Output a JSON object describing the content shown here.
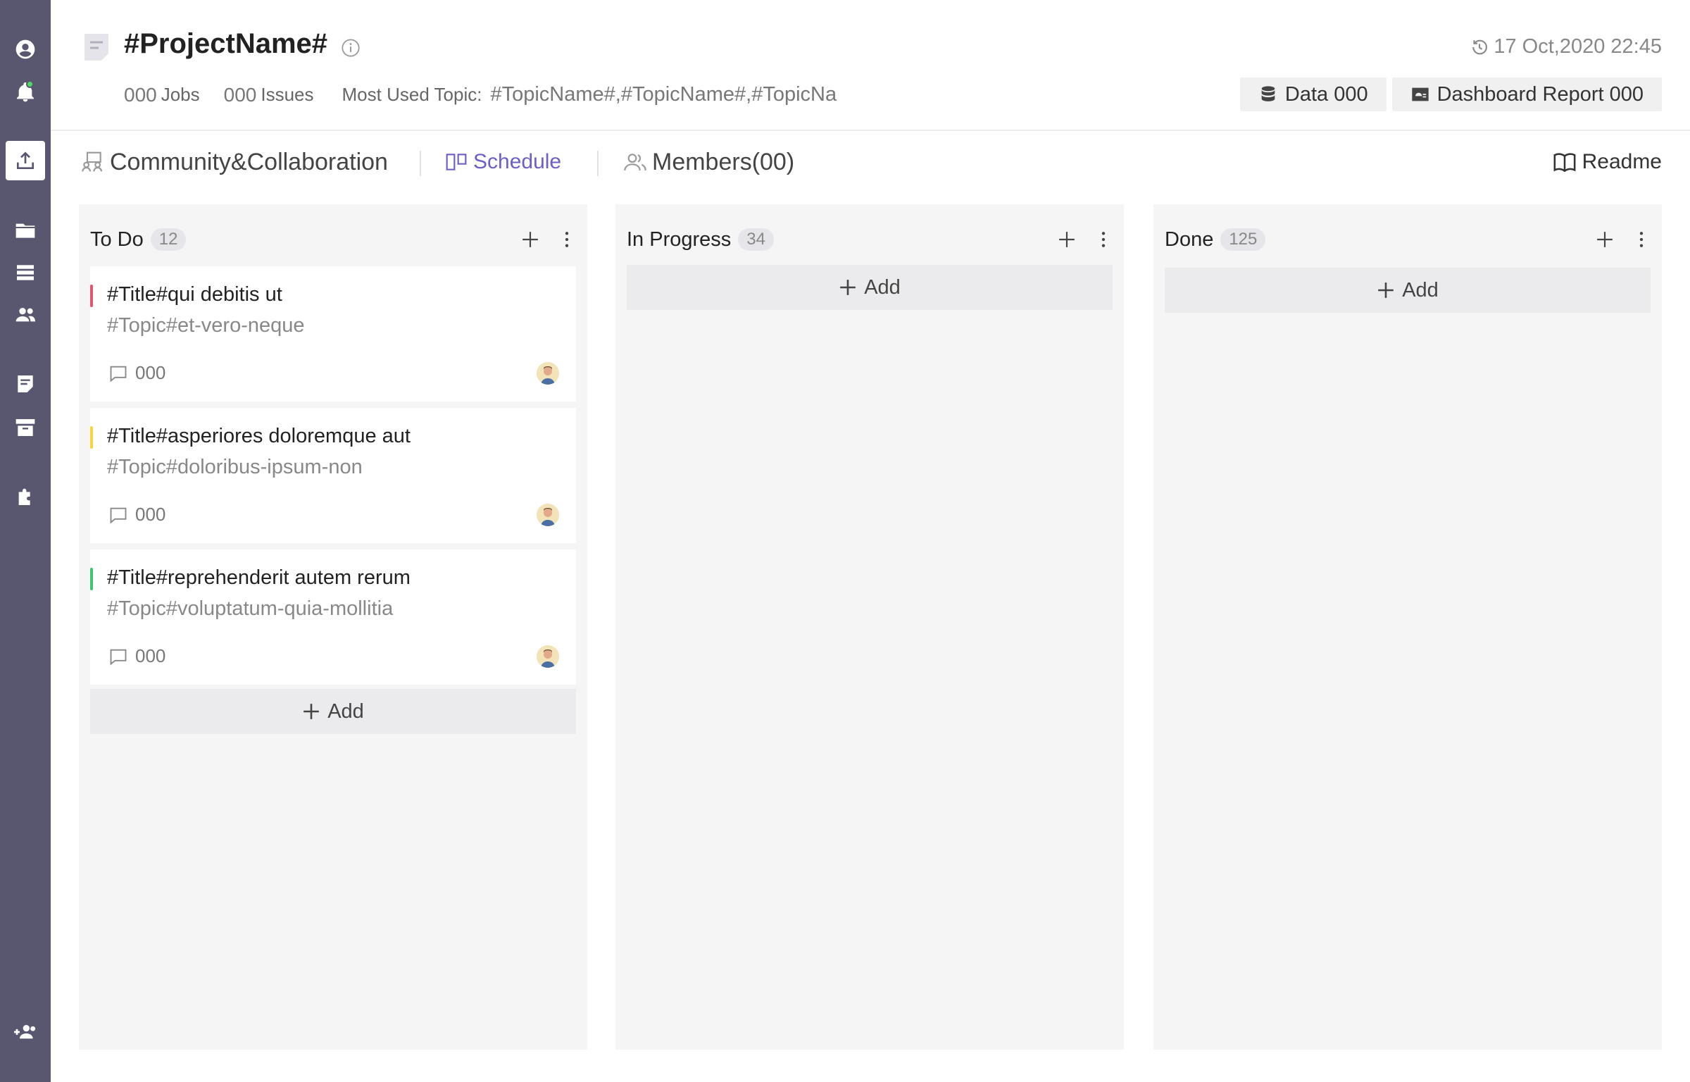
{
  "sidebar": {
    "icons": [
      "user-circle-icon",
      "bell-icon",
      "upload-icon",
      "folder-icon",
      "stack-icon",
      "users-icon",
      "note-icon",
      "archive-icon",
      "puzzle-icon",
      "add-user-icon"
    ],
    "active": "upload-icon"
  },
  "header": {
    "title": "#ProjectName#",
    "timestamp": "17 Oct,2020 22:45",
    "jobs_count": "000",
    "jobs_label": "Jobs",
    "issues_count": "000",
    "issues_label": "Issues",
    "topics_label": "Most Used Topic:",
    "topics": "#TopicName#,#TopicName#,#TopicNa",
    "data_button": "Data 000",
    "dashboard_button": "Dashboard Report 000"
  },
  "tabs": {
    "community": "Community&Collaboration",
    "schedule": "Schedule",
    "members": "Members(00)",
    "readme": "Readme"
  },
  "board": {
    "columns": [
      {
        "title": "To Do",
        "count": "12",
        "add_label": "Add",
        "cards": [
          {
            "title": "#Title#qui debitis ut",
            "topic": "#Topic#et-vero-neque",
            "comments": "000",
            "color": "#e0566e"
          },
          {
            "title": "#Title#asperiores doloremque aut",
            "topic": "#Topic#doloribus-ipsum-non",
            "comments": "000",
            "color": "#f5d63d"
          },
          {
            "title": "#Title#reprehenderit autem rerum",
            "topic": "#Topic#voluptatum-quia-mollitia",
            "comments": "000",
            "color": "#3ec46d"
          }
        ]
      },
      {
        "title": "In Progress",
        "count": "34",
        "add_label": "Add",
        "cards": []
      },
      {
        "title": "Done",
        "count": "125",
        "add_label": "Add",
        "cards": []
      }
    ]
  },
  "colors": {
    "sidebar": "#595770",
    "accent": "#6b5fc7",
    "column_bg": "#f5f5f5",
    "notification": "#4cd964"
  }
}
